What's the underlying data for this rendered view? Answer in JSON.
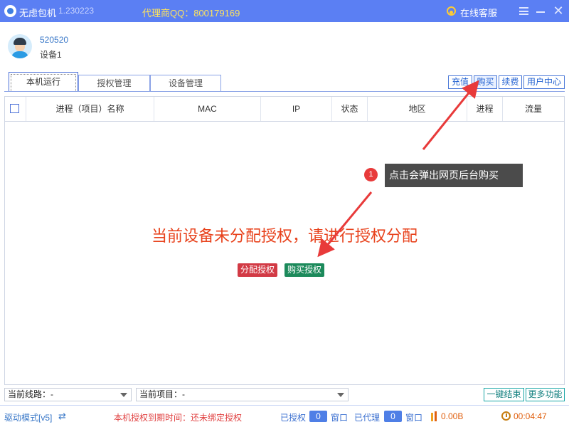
{
  "titlebar": {
    "app_name": "无虑包机",
    "version": "1.230223",
    "agent_qq": "代理商QQ：800179169",
    "support_label": "在线客服"
  },
  "user": {
    "id": "520520",
    "device": "设备1"
  },
  "tabs": [
    {
      "label": "本机运行",
      "active": true
    },
    {
      "label": "授权管理",
      "active": false
    },
    {
      "label": "设备管理",
      "active": false
    }
  ],
  "right_buttons": [
    "充值",
    "购买",
    "续费",
    "用户中心"
  ],
  "table": {
    "columns": [
      "进程（项目）名称",
      "MAC",
      "IP",
      "状态",
      "地区",
      "进程",
      "流量"
    ],
    "rows": []
  },
  "empty_message": "当前设备未分配授权，请进行授权分配",
  "actions": {
    "assign": "分配授权",
    "buy": "购买授权"
  },
  "annotation": {
    "number": "1",
    "text": "点击会弹出网页后台购买"
  },
  "selectors": {
    "route": "当前线路：-",
    "project": "当前项目：-"
  },
  "bottom_buttons": {
    "end_all": "一键结束",
    "more": "更多功能"
  },
  "statusbar": {
    "driver_mode": "驱动模式[v5]",
    "expiry": "本机授权到期时间：还未绑定授权",
    "authorized_label": "已授权",
    "authorized_count": "0",
    "window1": "窗口",
    "proxied_label": "已代理",
    "proxied_count": "0",
    "window2": "窗口",
    "traffic": "0.00B",
    "elapsed": "00:04:47"
  },
  "colors": {
    "titlebar": "#5b7ff3",
    "agent_qq": "#ffe45c",
    "empty_message": "#e8421c",
    "assign_button": "#d23a45",
    "buy_button": "#1c8a5b",
    "annotation_arrow": "#e83a3a",
    "expiry_text": "#e04040"
  }
}
